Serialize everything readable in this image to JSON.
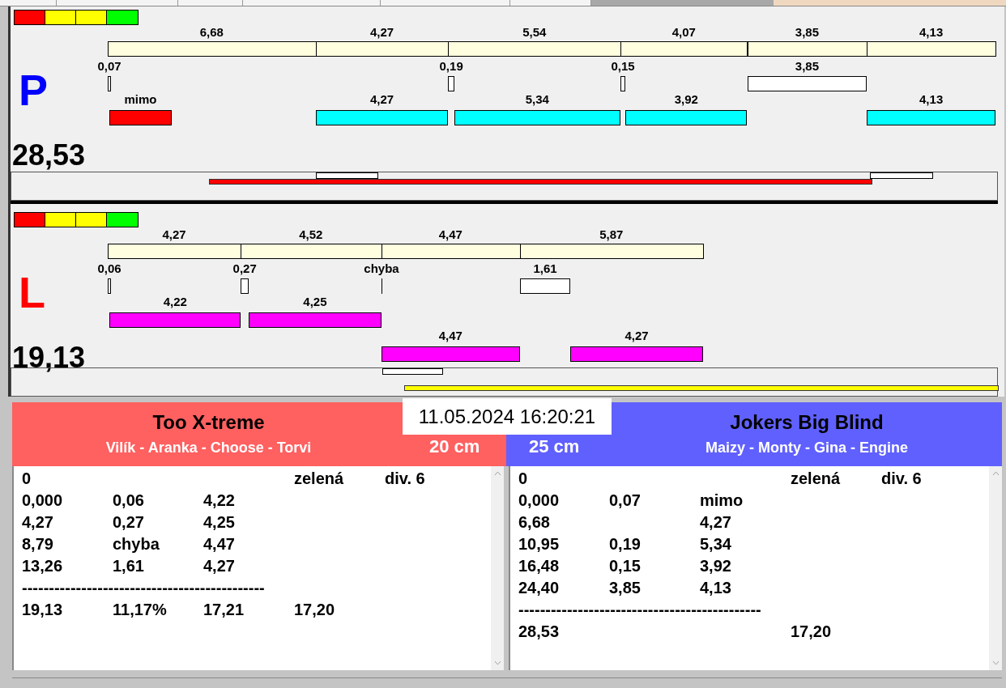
{
  "panels": [
    {
      "letter": "P",
      "color": "#0000ff",
      "signal_segments": [
        {
          "color": "#ff0000"
        },
        {
          "color": "#ffff00"
        },
        {
          "color": "#ffff00"
        },
        {
          "color": "#00ff00"
        }
      ],
      "total": "28,53",
      "strip": {
        "color": "#ff0000"
      },
      "segments": [
        {
          "length": "6,68",
          "gap": {
            "label": "0,07",
            "kind": "time"
          },
          "run": {
            "label": "mimo",
            "kind": "miss",
            "color": "#ff0000"
          }
        },
        {
          "length": "4,27",
          "run": {
            "label": "4,27",
            "kind": "upper",
            "color": "#00ffff"
          }
        },
        {
          "length": "5,54",
          "gap": {
            "label": "0,19",
            "kind": "time"
          },
          "run": {
            "label": "5,34",
            "kind": "upper",
            "color": "#00ffff"
          }
        },
        {
          "length": "4,07",
          "gap": {
            "label": "0,15",
            "kind": "time"
          },
          "run": {
            "label": "3,92",
            "kind": "upper",
            "color": "#00ffff"
          }
        },
        {
          "length": "3,85",
          "gap": {
            "label": "3,85",
            "kind": "time"
          }
        },
        {
          "length": "4,13",
          "run": {
            "label": "4,13",
            "kind": "upper",
            "color": "#00ffff"
          }
        }
      ]
    },
    {
      "letter": "L",
      "color": "#ff0000",
      "signal_segments": [
        {
          "color": "#ff0000"
        },
        {
          "color": "#ffff00"
        },
        {
          "color": "#ffff00"
        },
        {
          "color": "#00ff00"
        }
      ],
      "total": "19,13",
      "strip": {
        "color": "#ffff00"
      },
      "segments": [
        {
          "length": "4,27",
          "gap": {
            "label": "0,06",
            "kind": "time"
          },
          "run": {
            "label": "4,22",
            "kind": "upper",
            "color": "#ff00ff"
          }
        },
        {
          "length": "4,52",
          "gap": {
            "label": "0,27",
            "kind": "time"
          },
          "run": {
            "label": "4,25",
            "kind": "upper",
            "color": "#ff00ff"
          }
        },
        {
          "length": "4,47",
          "gap": {
            "label": "chyba",
            "kind": "fault"
          },
          "run": {
            "label": "4,47",
            "kind": "lower",
            "color": "#ff00ff"
          }
        },
        {
          "length": "5,87",
          "gap": {
            "label": "1,61",
            "kind": "time"
          },
          "run": {
            "label": "4,27",
            "kind": "lower",
            "color": "#ff00ff"
          }
        }
      ]
    }
  ],
  "date": "11.05.2024 16:20:21",
  "teams": [
    {
      "name": "Too X-treme",
      "players": "Vilík - Aranka - Choose - Torvi",
      "distance": "20 cm",
      "color": "#ff6060",
      "lines": [
        {
          "kind": "values",
          "cells": [
            "0",
            null,
            null,
            "zelená",
            "div. 6"
          ]
        },
        {
          "kind": "values",
          "cells": [
            "0,000",
            "0,06",
            "4,22"
          ]
        },
        {
          "kind": "values",
          "cells": [
            "4,27",
            "0,27",
            "4,25"
          ]
        },
        {
          "kind": "values",
          "cells": [
            "8,79",
            "chyba",
            "4,47"
          ]
        },
        {
          "kind": "values",
          "cells": [
            "13,26",
            "1,61",
            "4,27"
          ]
        },
        {
          "kind": "rule",
          "text": "---------------------------------------------"
        },
        {
          "kind": "values",
          "cells": [
            "19,13",
            "11,17%",
            "17,21",
            "17,20"
          ]
        }
      ]
    },
    {
      "name": "Jokers Big Blind",
      "players": "Maizy - Monty - Gina - Engine",
      "distance": "25 cm",
      "color": "#6060ff",
      "lines": [
        {
          "kind": "values",
          "cells": [
            "0",
            null,
            null,
            "zelená",
            "div. 6"
          ]
        },
        {
          "kind": "values",
          "cells": [
            "0,000",
            "0,07",
            "mimo"
          ]
        },
        {
          "kind": "values",
          "cells": [
            "6,68",
            null,
            "4,27"
          ]
        },
        {
          "kind": "values",
          "cells": [
            "10,95",
            "0,19",
            "5,34"
          ]
        },
        {
          "kind": "values",
          "cells": [
            "16,48",
            "0,15",
            "3,92"
          ]
        },
        {
          "kind": "values",
          "cells": [
            "24,40",
            "3,85",
            "4,13"
          ]
        },
        {
          "kind": "rule",
          "text": "---------------------------------------------"
        },
        {
          "kind": "values",
          "cells": [
            "28,53",
            null,
            null,
            "17,20"
          ]
        }
      ]
    }
  ]
}
